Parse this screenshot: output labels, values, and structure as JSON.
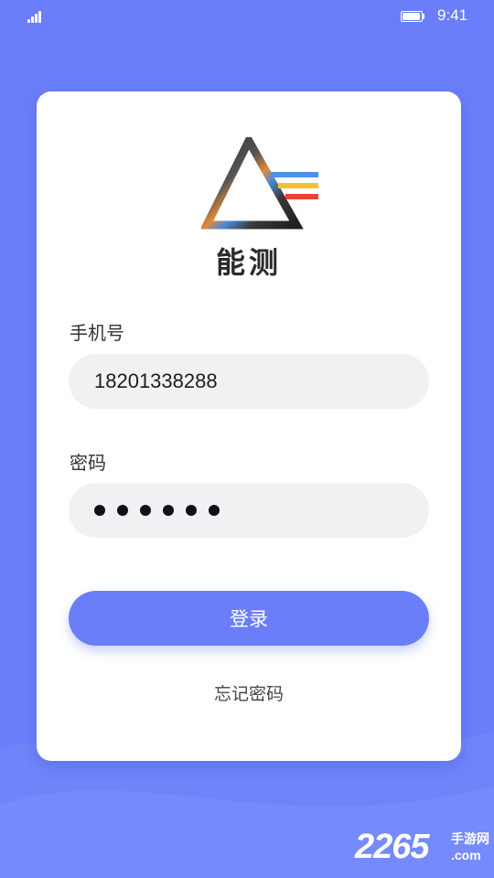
{
  "status_bar": {
    "time": "9:41",
    "signal_icon": "signal-bars-icon",
    "battery_icon": "battery-icon"
  },
  "app": {
    "logo_icon": "prism-logo-icon",
    "name": "能测"
  },
  "form": {
    "phone_label": "手机号",
    "phone_value": "18201338288",
    "password_label": "密码",
    "password_length": 6,
    "login_label": "登录",
    "forgot_label": "忘记密码"
  },
  "colors": {
    "background": "#6A7EF9",
    "primary": "#6A7EF9",
    "card": "#FFFFFF",
    "field": "#F1F1F3"
  },
  "watermark": {
    "number": "2265",
    "cn": "手游网",
    "en": ".com"
  }
}
